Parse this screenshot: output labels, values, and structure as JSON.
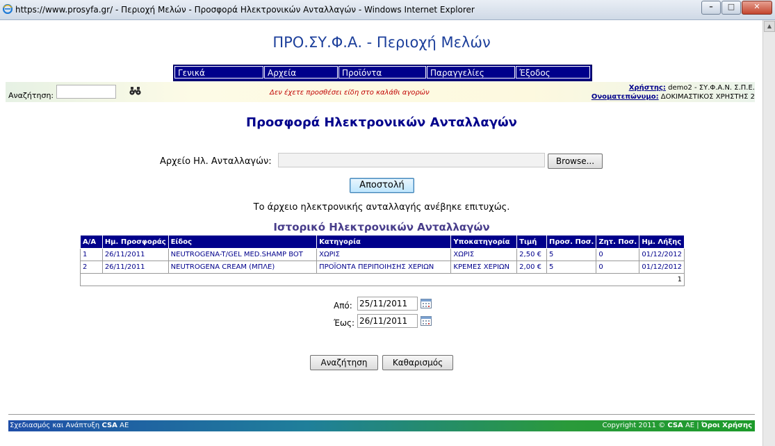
{
  "window": {
    "title": "https://www.prosyfa.gr/ - Περιοχή Μελών - Προσφορά Ηλεκτρονικών Ανταλλαγών - Windows Internet Explorer"
  },
  "site": {
    "title": "ΠΡΟ.ΣΥ.Φ.Α. - Περιοχή Μελών"
  },
  "menu": {
    "items": [
      {
        "label": "Γενικά"
      },
      {
        "label": "Αρχεία"
      },
      {
        "label": "Προϊόντα"
      },
      {
        "label": "Παραγγελίες"
      },
      {
        "label": "Έξοδος"
      }
    ]
  },
  "infobar": {
    "search_label": "Αναζήτηση:",
    "search_value": "",
    "cart_message": "Δεν έχετε προσθέσει είδη στο καλάθι αγορών",
    "user_label": "Χρήστης:",
    "user_value": "demo2 - ΣΥ.Φ.Α.Ν. Σ.Π.Ε.",
    "fullname_label": "Ονοματεπώνυμο:",
    "fullname_value": "ΔΟΚΙΜΑΣΤΙΚΟΣ ΧΡΗΣΤΗΣ 2"
  },
  "main": {
    "heading": "Προσφορά Ηλεκτρονικών Ανταλλαγών",
    "file_label": "Αρχείο Ηλ. Ανταλλαγών:",
    "file_value": "",
    "browse_label": "Browse...",
    "send_label": "Αποστολή",
    "success_message": "Το άρχειο ηλεκτρονικής ανταλλαγής ανέβηκε επιτυχώς.",
    "history_title": "Ιστορικό Ηλεκτρονικών Ανταλλαγών"
  },
  "history_table": {
    "columns": [
      "Α/Α",
      "Ημ. Προσφοράς",
      "Είδος",
      "Κατηγορία",
      "Υποκατηγορία",
      "Τιμή",
      "Προσ. Ποσ.",
      "Ζητ. Ποσ.",
      "Ημ. Λήξης"
    ],
    "rows": [
      [
        "1",
        "26/11/2011",
        "NEUTROGENA-T/GEL MED.SHAMP BOT",
        "ΧΩΡΙΣ",
        "ΧΩΡΙΣ",
        "2,50 €",
        "5",
        "0",
        "01/12/2012"
      ],
      [
        "2",
        "26/11/2011",
        "NEUTROGENA CREAM (ΜΠΛΕ)",
        "ΠΡΟΪΟΝΤΑ ΠΕΡΙΠΟΙΗΣΗΣ ΧΕΡΙΩΝ",
        "ΚΡΕΜΕΣ ΧΕΡΙΩΝ",
        "2,00 €",
        "5",
        "0",
        "01/12/2012"
      ]
    ],
    "pager": "1"
  },
  "filters": {
    "from_label": "Από:",
    "from_value": "25/11/2011",
    "to_label": "Έως:",
    "to_value": "26/11/2011",
    "search_button": "Αναζήτηση",
    "clear_button": "Καθαρισμός"
  },
  "footer": {
    "left_prefix": "Σχεδιασμός και Ανάπτυξη ",
    "left_brand": "CSA",
    "left_suffix": " AE",
    "right_prefix": "Copyright 2011 © ",
    "right_brand": "CSA",
    "right_suffix": " AE",
    "terms_link": "Όροι Χρήσης"
  },
  "colors": {
    "menu_bg": "#00008b",
    "heading": "#00008b",
    "history_title": "#483d8b",
    "cart_message": "#c00000"
  },
  "icons": {
    "browser": "internet-explorer-icon",
    "search": "binoculars-icon",
    "calendar": "calendar-icon"
  }
}
